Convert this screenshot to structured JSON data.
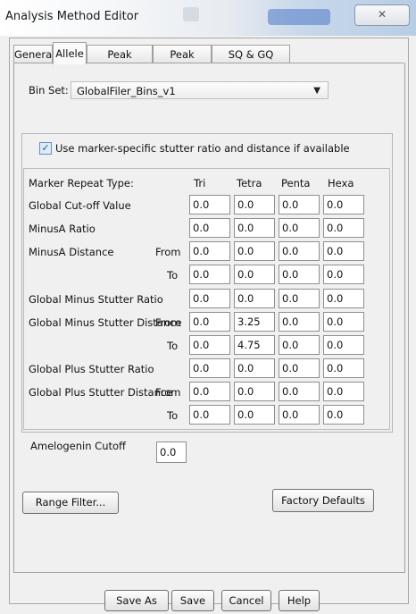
{
  "window": {
    "title": "Analysis Method Editor",
    "close_glyph": "✕"
  },
  "tabs": [
    {
      "label": "General",
      "active": false
    },
    {
      "label": "Allele",
      "active": true
    },
    {
      "label": "Peak Detector",
      "active": false
    },
    {
      "label": "Peak Quality",
      "active": false
    },
    {
      "label": "SQ & GQ Settings",
      "active": false
    }
  ],
  "bin_set": {
    "label": "Bin Set:",
    "value": "GlobalFiler_Bins_v1"
  },
  "stutter": {
    "checkbox_label": "Use marker-specific stutter ratio and distance if available",
    "checked": true,
    "header": {
      "label": "Marker Repeat Type:",
      "columns": [
        "Tri",
        "Tetra",
        "Penta",
        "Hexa"
      ]
    },
    "rows": [
      {
        "label": "Global Cut-off Value",
        "sub": "",
        "values": [
          "0.0",
          "0.0",
          "0.0",
          "0.0"
        ]
      },
      {
        "label": "MinusA Ratio",
        "sub": "",
        "values": [
          "0.0",
          "0.0",
          "0.0",
          "0.0"
        ]
      },
      {
        "label": "MinusA Distance",
        "sub": "From",
        "values": [
          "0.0",
          "0.0",
          "0.0",
          "0.0"
        ]
      },
      {
        "label": "",
        "sub": "To",
        "values": [
          "0.0",
          "0.0",
          "0.0",
          "0.0"
        ]
      },
      {
        "label": "Global Minus Stutter Ratio",
        "sub": "",
        "values": [
          "0.0",
          "0.0",
          "0.0",
          "0.0"
        ]
      },
      {
        "label": "Global Minus Stutter Distance",
        "sub": "From",
        "values": [
          "0.0",
          "3.25",
          "0.0",
          "0.0"
        ]
      },
      {
        "label": "",
        "sub": "To",
        "values": [
          "0.0",
          "4.75",
          "0.0",
          "0.0"
        ]
      },
      {
        "label": "Global Plus Stutter Ratio",
        "sub": "",
        "values": [
          "0.0",
          "0.0",
          "0.0",
          "0.0"
        ]
      },
      {
        "label": "Global Plus Stutter Distance",
        "sub": "From",
        "values": [
          "0.0",
          "0.0",
          "0.0",
          "0.0"
        ]
      },
      {
        "label": "",
        "sub": "To",
        "values": [
          "0.0",
          "0.0",
          "0.0",
          "0.0"
        ]
      }
    ]
  },
  "amelogenin": {
    "label": "Amelogenin Cutoff",
    "value": "0.0"
  },
  "buttons": {
    "range_filter": "Range Filter...",
    "factory_defaults": "Factory Defaults",
    "save_as": "Save As",
    "save": "Save",
    "cancel": "Cancel",
    "help": "Help"
  }
}
